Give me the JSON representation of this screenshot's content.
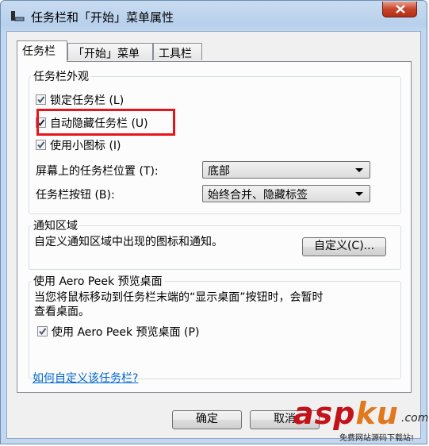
{
  "window": {
    "title": "任务栏和「开始」菜单属性"
  },
  "tabs": [
    {
      "label": "任务栏"
    },
    {
      "label": "「开始」菜单"
    },
    {
      "label": "工具栏"
    }
  ],
  "appearance": {
    "title": "任务栏外观",
    "lock_label": "锁定任务栏 (L)",
    "autohide_label": "自动隐藏任务栏 (U)",
    "small_icons_label": "使用小图标 (I)",
    "position_label": "屏幕上的任务栏位置 (T):",
    "position_value": "底部",
    "buttons_label": "任务栏按钮 (B):",
    "buttons_value": "始终合并、隐藏标签"
  },
  "notification": {
    "title": "通知区域",
    "text": "自定义通知区域中出现的图标和通知。",
    "customize_button": "自定义(C)..."
  },
  "aero": {
    "title": "使用 Aero Peek 预览桌面",
    "description_line1": "当您将鼠标移动到任务栏末端的“显示桌面”按钮时，会暂时",
    "description_line2": "查看桌面。",
    "checkbox_label": "使用 Aero Peek 预览桌面 (P)"
  },
  "help_link": "如何自定义该任务栏?",
  "buttons": {
    "ok": "确定",
    "cancel": "取消"
  },
  "watermark": {
    "brand_asp": "asp",
    "brand_ku": "ku",
    "dotcom": ".com",
    "tagline": "免费网站源码下载站!"
  },
  "colors": {
    "highlight_box": "#e8141c",
    "link": "#0066cc",
    "close_button": "#c8442b"
  }
}
